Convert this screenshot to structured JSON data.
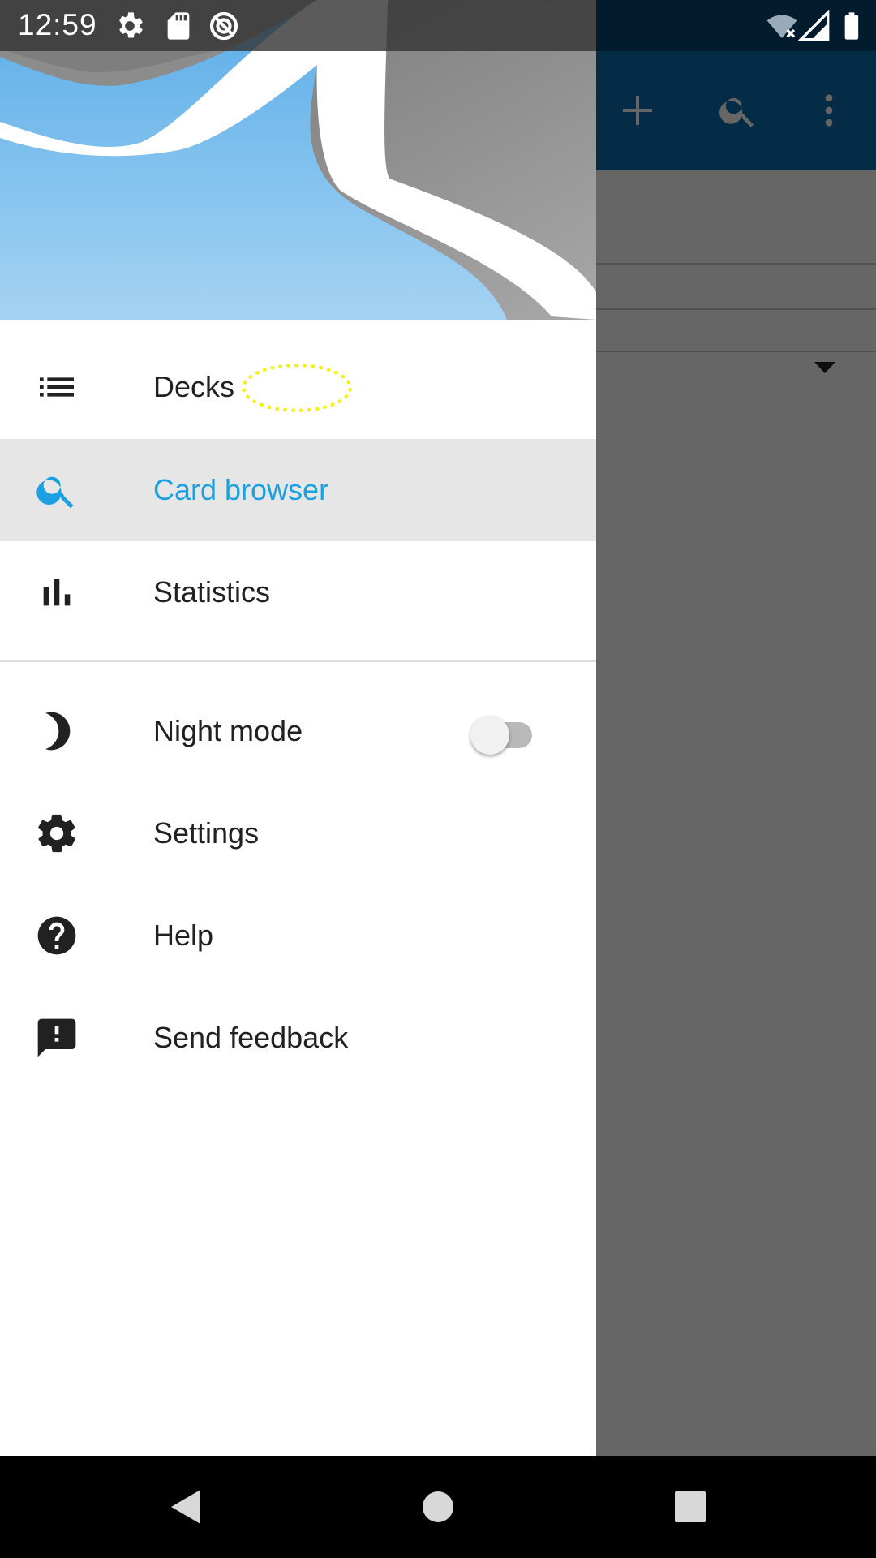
{
  "status_bar": {
    "time": "12:59",
    "left_icons": [
      "gear-icon",
      "sd-card-icon",
      "data-saver-icon"
    ],
    "right_icons": [
      "wifi-icon",
      "signal-icon",
      "battery-icon"
    ]
  },
  "toolbar": {
    "icons": [
      "add-icon",
      "search-icon",
      "more-vert-icon"
    ],
    "color": "#0a6fb0"
  },
  "drawer": {
    "header_colors": {
      "sky": "#6ab7ec",
      "gray": "#8a8a8a"
    },
    "items": [
      {
        "label": "Decks",
        "icon": "list-icon",
        "active": false
      },
      {
        "label": "Card browser",
        "icon": "search-icon",
        "active": true
      },
      {
        "label": "Statistics",
        "icon": "bar-chart-icon",
        "active": false
      }
    ],
    "secondary_items": [
      {
        "label": "Night mode",
        "icon": "moon-icon",
        "toggle": false
      },
      {
        "label": "Settings",
        "icon": "gear-icon"
      },
      {
        "label": "Help",
        "icon": "help-icon"
      },
      {
        "label": "Send feedback",
        "icon": "feedback-icon"
      }
    ],
    "accent": "#1ba1e2"
  },
  "nav_bar": {
    "buttons": [
      "back-icon",
      "home-icon",
      "recents-icon"
    ]
  }
}
